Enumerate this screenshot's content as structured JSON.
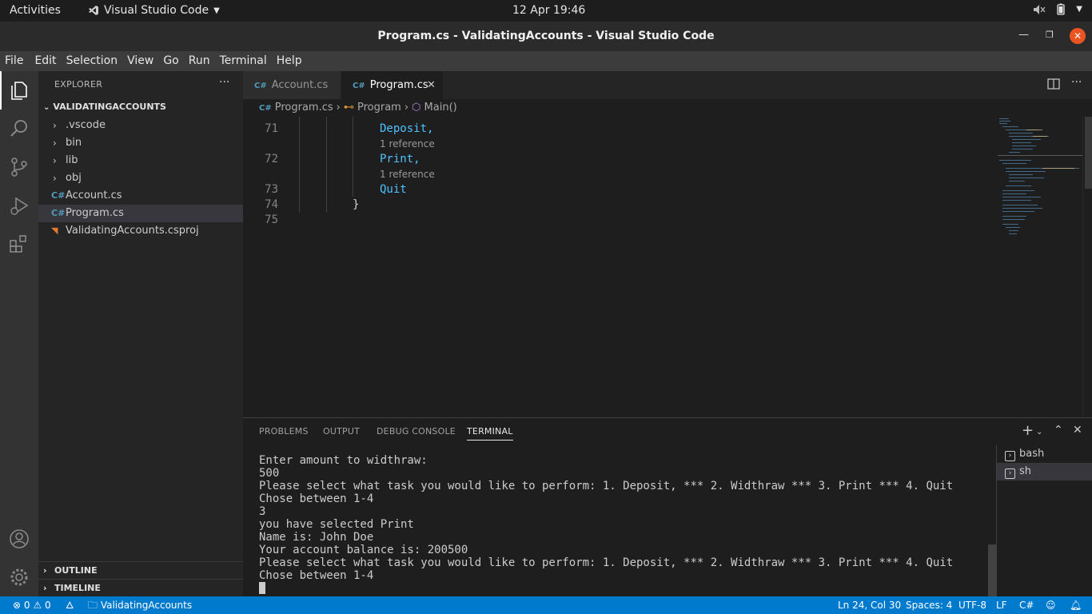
{
  "os_bar": {
    "activities": "Activities",
    "app_name": "Visual Studio Code",
    "clock": "12 Apr  19:46"
  },
  "window": {
    "title": "Program.cs - ValidatingAccounts - Visual Studio Code"
  },
  "menu": [
    "File",
    "Edit",
    "Selection",
    "View",
    "Go",
    "Run",
    "Terminal",
    "Help"
  ],
  "sidebar": {
    "header": "EXPLORER",
    "folder": "VALIDATINGACCOUNTS",
    "items": [
      {
        "label": ".vscode",
        "type": "folder"
      },
      {
        "label": "bin",
        "type": "folder"
      },
      {
        "label": "lib",
        "type": "folder"
      },
      {
        "label": "obj",
        "type": "folder"
      },
      {
        "label": "Account.cs",
        "type": "cs"
      },
      {
        "label": "Program.cs",
        "type": "cs",
        "selected": true
      },
      {
        "label": "ValidatingAccounts.csproj",
        "type": "rss"
      }
    ],
    "outline": "OUTLINE",
    "timeline": "TIMELINE"
  },
  "tabs": [
    {
      "label": "Account.cs",
      "active": false
    },
    {
      "label": "Program.cs",
      "active": true
    }
  ],
  "breadcrumb": [
    "Program.cs",
    "Program",
    "Main()"
  ],
  "editor": {
    "lines": [
      {
        "num": "71",
        "text": "Deposit,"
      },
      {
        "num": "72",
        "text": "Print,"
      },
      {
        "num": "73",
        "text": "Quit"
      },
      {
        "num": "74",
        "text": "}"
      },
      {
        "num": "75",
        "text": ""
      }
    ],
    "codelens": "1 reference"
  },
  "panel": {
    "tabs": [
      "PROBLEMS",
      "OUTPUT",
      "DEBUG CONSOLE",
      "TERMINAL"
    ],
    "active_tab": "TERMINAL",
    "terminal_lines": [
      "Enter amount to widthraw:",
      "500",
      "Please select what task you would like to perform: 1. Deposit, *** 2. Widthraw *** 3. Print *** 4. Quit",
      "Chose between 1-4",
      "3",
      "you have selected Print",
      "Name is: John Doe",
      "Your account balance is: 200500",
      "Please select what task you would like to perform: 1. Deposit, *** 2. Widthraw *** 3. Print *** 4. Quit",
      "Chose between 1-4"
    ],
    "terminals": [
      {
        "label": "bash",
        "selected": false
      },
      {
        "label": "sh",
        "selected": true
      }
    ]
  },
  "status": {
    "errors": "0",
    "warnings": "0",
    "folder": "ValidatingAccounts",
    "position": "Ln 24, Col 30",
    "spaces": "Spaces: 4",
    "encoding": "UTF-8",
    "eol": "LF",
    "language": "C#"
  },
  "colors": {
    "accent": "#007acc",
    "close_button": "#e95420",
    "cs_icon": "#519aba",
    "enum_member": "#4fc1ff"
  }
}
